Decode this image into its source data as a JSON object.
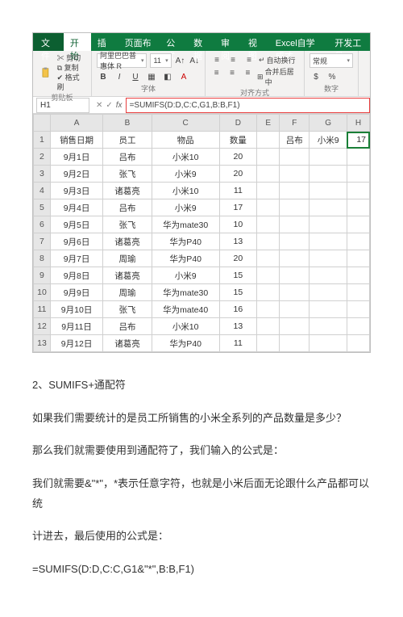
{
  "tabs": {
    "file": "文件",
    "items": [
      "开始",
      "插入",
      "页面布局",
      "公式",
      "数据",
      "审阅",
      "视图",
      "Excel自学成才",
      "开发工具"
    ],
    "activeIndex": 0
  },
  "ribbon": {
    "clipboard": {
      "cut": "剪切",
      "copy": "复制",
      "formatPainter": "格式刷",
      "group": "剪贴板"
    },
    "font": {
      "name": "阿里巴巴普惠体 R",
      "size": "11",
      "group": "字体"
    },
    "alignment": {
      "wrap": "自动换行",
      "merge": "合并后居中",
      "group": "对齐方式"
    },
    "number": {
      "format": "常规",
      "group": "数字"
    }
  },
  "formulaBar": {
    "nameBox": "H1",
    "formula": "=SUMIFS(D:D,C:C,G1,B:B,F1)"
  },
  "grid": {
    "cols": [
      "A",
      "B",
      "C",
      "D",
      "E",
      "F",
      "G",
      "H"
    ],
    "header": {
      "A": "销售日期",
      "B": "员工",
      "C": "物品",
      "D": "数量"
    },
    "rows": [
      {
        "A": "9月1日",
        "B": "吕布",
        "C": "小米10",
        "D": "20"
      },
      {
        "A": "9月2日",
        "B": "张飞",
        "C": "小米9",
        "D": "20"
      },
      {
        "A": "9月3日",
        "B": "诸葛亮",
        "C": "小米10",
        "D": "11"
      },
      {
        "A": "9月4日",
        "B": "吕布",
        "C": "小米9",
        "D": "17"
      },
      {
        "A": "9月5日",
        "B": "张飞",
        "C": "华为mate30",
        "D": "10"
      },
      {
        "A": "9月6日",
        "B": "诸葛亮",
        "C": "华为P40",
        "D": "13"
      },
      {
        "A": "9月7日",
        "B": "周瑜",
        "C": "华为P40",
        "D": "20"
      },
      {
        "A": "9月8日",
        "B": "诸葛亮",
        "C": "小米9",
        "D": "15"
      },
      {
        "A": "9月9日",
        "B": "周瑜",
        "C": "华为mate30",
        "D": "15"
      },
      {
        "A": "9月10日",
        "B": "张飞",
        "C": "华为mate40",
        "D": "16"
      },
      {
        "A": "9月11日",
        "B": "吕布",
        "C": "小米10",
        "D": "13"
      },
      {
        "A": "9月12日",
        "B": "诸葛亮",
        "C": "华为P40",
        "D": "11"
      }
    ],
    "extra": {
      "F1": "吕布",
      "G1": "小米9",
      "H1": "17"
    }
  },
  "article": {
    "p1": "2、SUMIFS+通配符",
    "p2": "如果我们需要统计的是员工所销售的小米全系列的产品数量是多少？",
    "p3": "那么我们就需要使用到通配符了，我们输入的公式是：",
    "p4": "我们就需要&\"*\"，*表示任意字符，也就是小米后面无论跟什么产品都可以统",
    "p5": "计进去，最后使用的公式是：",
    "p6": "=SUMIFS(D:D,C:C,G1&\"*\",B:B,F1)"
  }
}
